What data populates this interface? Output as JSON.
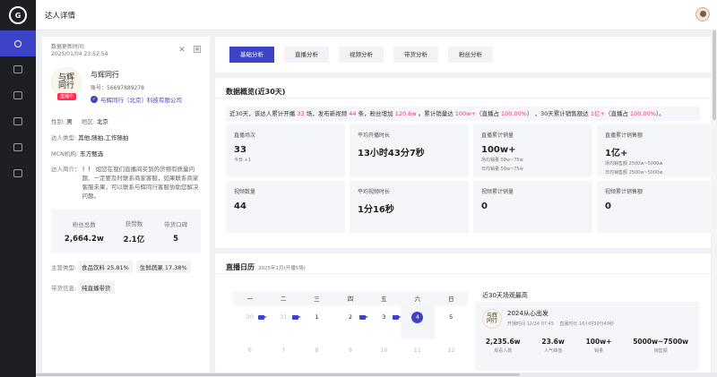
{
  "app": {
    "logo": "G"
  },
  "header": {
    "title": "达人详情"
  },
  "profile": {
    "update_label": "数据更新时间:",
    "update_time": "2025/01/04 23:52:54",
    "avatar_text": "与辉同行",
    "live_badge": "直播中",
    "name": "与辉同行",
    "account": "账号：56697889278",
    "org": "与辉同行（北京）科技有限公司",
    "gender_label": "性别:",
    "gender": "男",
    "region_label": "地区:",
    "region": "北京",
    "type_label": "达人类型:",
    "type": "其他,随拍,工作随拍",
    "mcn_label": "MCN机构:",
    "mcn": "东方甄选",
    "intro_label": "达人简介：",
    "intro_warn": "！！",
    "intro_text": "如您在我们直播间买到的货物有质量问题、一定要及时联系商家客服，如果联系商家客服未果，可以联系与辉同行客服协助您解决问题。",
    "stats": [
      {
        "label": "粉丝总数",
        "value": "2,664.2w"
      },
      {
        "label": "获赞数",
        "value": "2.1亿"
      },
      {
        "label": "带货口碑",
        "value": "5"
      }
    ],
    "main_type_label": "主营类型:",
    "main_types": [
      "食品饮料 25.81%",
      "生鲜蔬果 17.38%"
    ],
    "goods_label": "带货信息:",
    "goods_tag": "纯直播带货"
  },
  "tabs": [
    "基础分析",
    "直播分析",
    "视频分析",
    "带货分析",
    "粉丝分析"
  ],
  "overview": {
    "title": "数据概览(近30天)",
    "summary": {
      "p1": "近30天，该达人累计开播 ",
      "n1": "33",
      "p2": " 场，发布新视频 ",
      "n2": "44",
      "p3": " 条，粉丝增加 ",
      "n3": "120.6w",
      "p4": " 。累计销量达 ",
      "n4": "100w+",
      "p5": "（直播占 ",
      "n5": "100.00%",
      "p6": "） ，30天累计销售额达 ",
      "n6": "1亿+",
      "p7": "（直播占 ",
      "n7": "100.00%",
      "p8": "）。"
    },
    "metrics": [
      {
        "label": "直播场次",
        "value": "33",
        "sub1": "今日 +1",
        "sub2": ""
      },
      {
        "label": "平均开播时长",
        "value": "13小时43分7秒",
        "sub1": "",
        "sub2": ""
      },
      {
        "label": "直播累计销量",
        "value": "100w+",
        "sub1": "场均销量 50w~75w",
        "sub2": "日均销量 50w~75w"
      },
      {
        "label": "直播累计销售额",
        "value": "1亿+",
        "sub1": "场均销售额 2500w~5000w",
        "sub2": "日均销售额 2500w~5000w"
      },
      {
        "label": "视频数量",
        "value": "44",
        "sub1": "",
        "sub2": ""
      },
      {
        "label": "平均视频时长",
        "value": "1分16秒",
        "sub1": "",
        "sub2": ""
      },
      {
        "label": "视频累计销量",
        "value": "0",
        "sub1": "",
        "sub2": ""
      },
      {
        "label": "视频累计销售额",
        "value": "0",
        "sub1": "",
        "sub2": ""
      }
    ]
  },
  "calendar": {
    "title": "直播日历",
    "sub": "2025年1月(开播5场)",
    "weekdays": [
      "一",
      "二",
      "三",
      "四",
      "五",
      "六",
      "日"
    ],
    "week1": [
      "30",
      "31",
      "1",
      "2",
      "3",
      "4",
      "5"
    ],
    "week2": [
      "6",
      "7",
      "8",
      "9",
      "10",
      "11",
      "12"
    ]
  },
  "top_live": {
    "title": "近30天场观最高",
    "avatar_text": "与辉同行",
    "name": "2024从心出发",
    "start": "开播时间  12/24 07:45",
    "duration": "直播时长  16小时39分49秒",
    "stats": [
      {
        "value": "2,235.6w",
        "label": "观看人数"
      },
      {
        "value": "23.6w",
        "label": "人气峰值"
      },
      {
        "value": "100w+",
        "label": "销量"
      },
      {
        "value": "5000w~7500w",
        "label": "销售额"
      }
    ]
  }
}
